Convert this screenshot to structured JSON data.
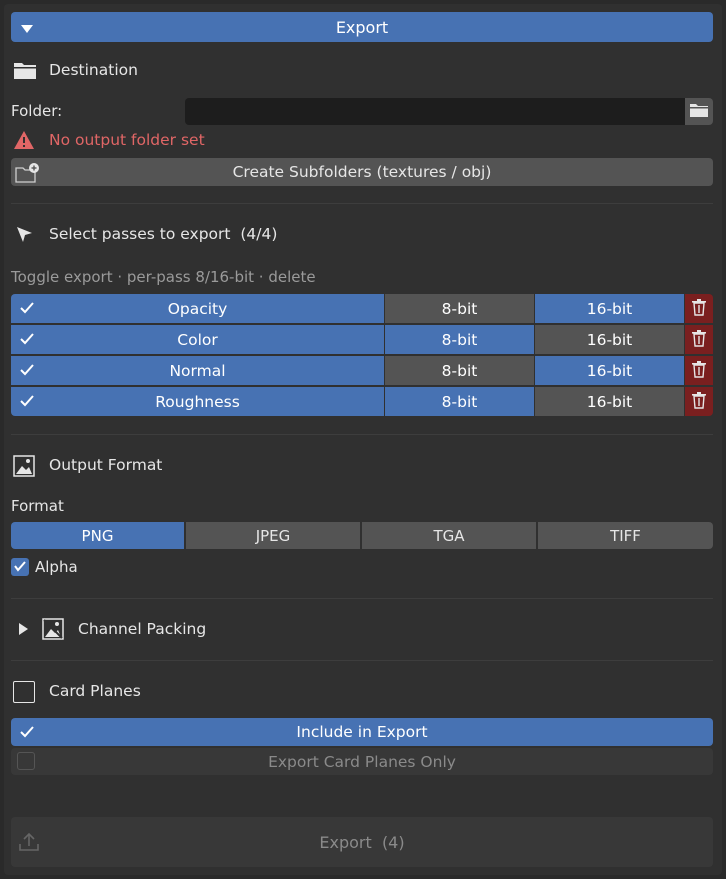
{
  "header": {
    "title": "Export"
  },
  "destination": {
    "section_title": "Destination",
    "folder_label": "Folder:",
    "folder_value": "",
    "warning": "No output folder set",
    "create_subfolders_label": "Create Subfolders (textures / obj)"
  },
  "passes": {
    "section_title": "Select passes to export  (4/4)",
    "hint": "Toggle export · per-pass 8/16-bit · delete",
    "rows": [
      {
        "name": "Opacity",
        "enabled": true,
        "bit8": "8-bit",
        "bit16": "16-bit",
        "selected_depth": "16"
      },
      {
        "name": "Color",
        "enabled": true,
        "bit8": "8-bit",
        "bit16": "16-bit",
        "selected_depth": "8"
      },
      {
        "name": "Normal",
        "enabled": true,
        "bit8": "8-bit",
        "bit16": "16-bit",
        "selected_depth": "16"
      },
      {
        "name": "Roughness",
        "enabled": true,
        "bit8": "8-bit",
        "bit16": "16-bit",
        "selected_depth": "8"
      }
    ]
  },
  "output_format": {
    "section_title": "Output Format",
    "format_label": "Format",
    "options": [
      "PNG",
      "JPEG",
      "TGA",
      "TIFF"
    ],
    "selected": "PNG",
    "alpha_label": "Alpha",
    "alpha_checked": true
  },
  "channel_packing": {
    "section_title": "Channel Packing",
    "expanded": false
  },
  "card_planes": {
    "section_title": "Card Planes",
    "enabled": false,
    "include_label": "Include in Export",
    "include_checked": true,
    "only_label": "Export Card Planes Only",
    "only_checked": false
  },
  "footer": {
    "export_label": "Export  (4)"
  },
  "colors": {
    "accent": "#4772b3",
    "warning": "#e06666",
    "danger": "#7a1f1f"
  }
}
